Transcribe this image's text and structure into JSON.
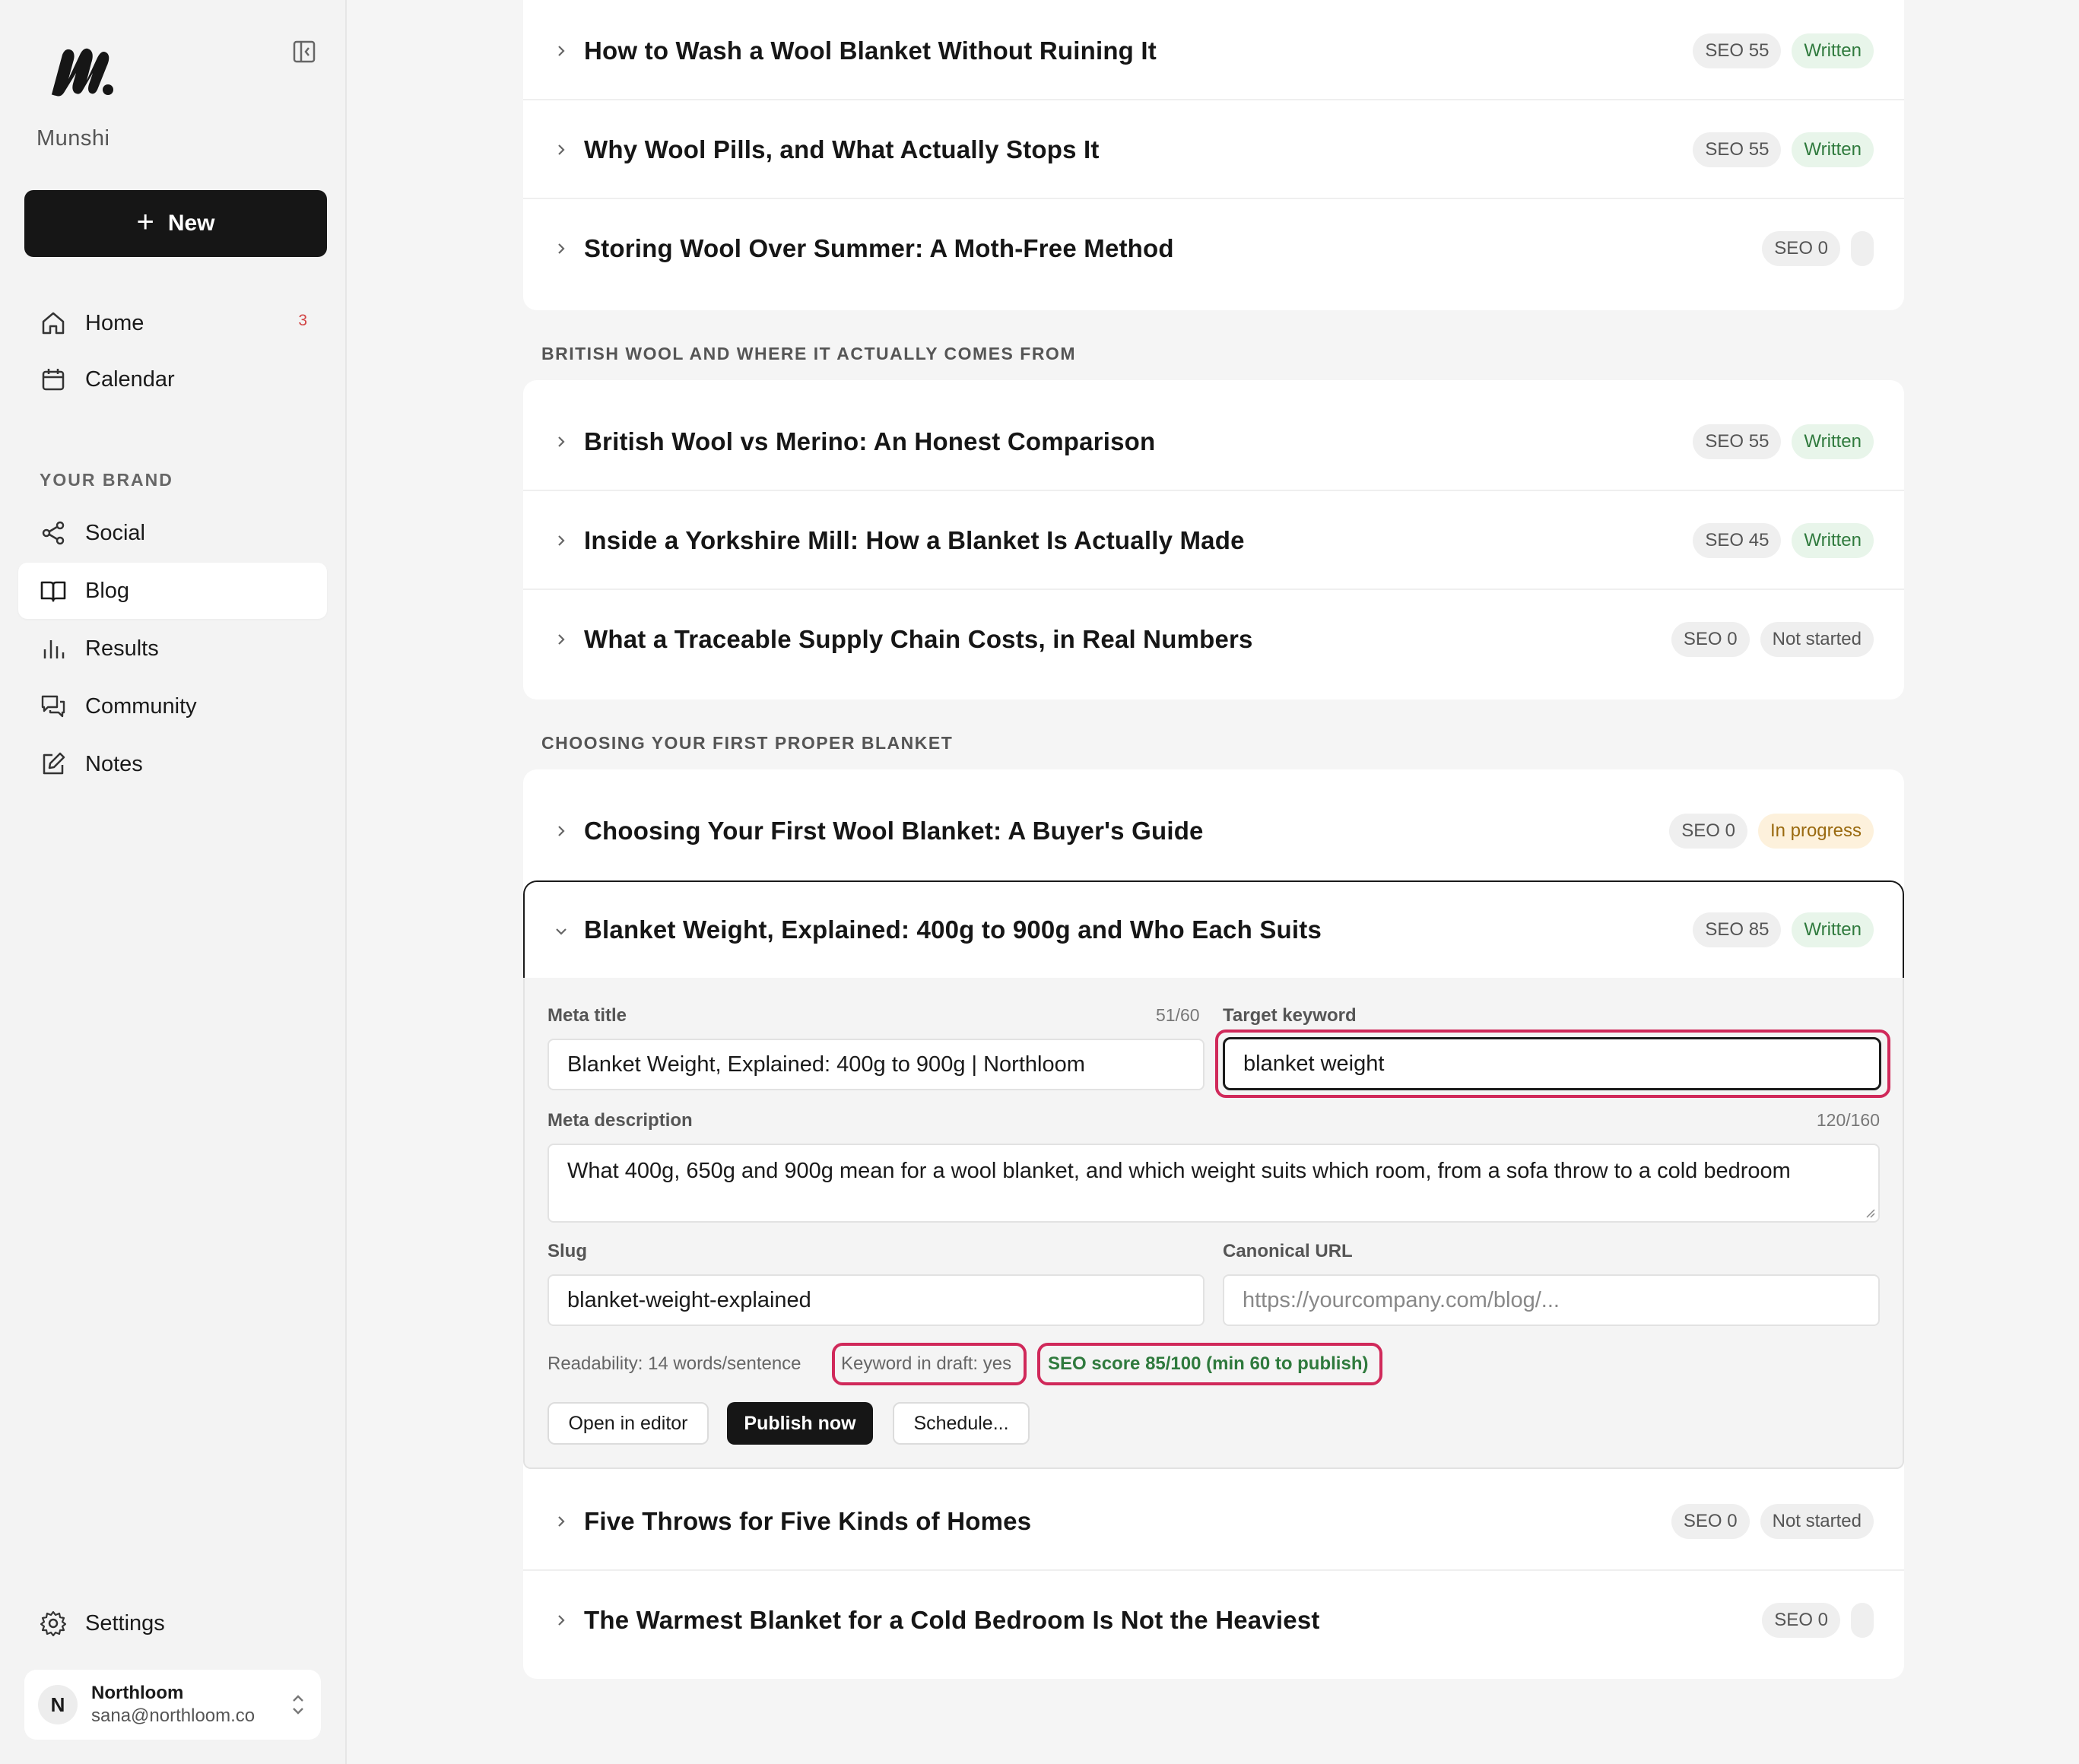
{
  "brand": {
    "name": "Munshi"
  },
  "sidebar": {
    "new_label": "New",
    "nav": [
      {
        "label": "Home",
        "badge": "3",
        "icon": "home-icon"
      },
      {
        "label": "Calendar",
        "icon": "calendar-icon"
      }
    ],
    "section_label": "YOUR BRAND",
    "brand_nav": [
      {
        "label": "Social",
        "icon": "share-icon"
      },
      {
        "label": "Blog",
        "icon": "book-icon",
        "active": true
      },
      {
        "label": "Results",
        "icon": "bar-chart-icon"
      },
      {
        "label": "Community",
        "icon": "chat-icon"
      },
      {
        "label": "Notes",
        "icon": "edit-icon"
      }
    ],
    "settings_label": "Settings",
    "account": {
      "initial": "N",
      "name": "Northloom",
      "email": "sana@northloom.co"
    }
  },
  "groups": [
    {
      "label": "",
      "posts": [
        {
          "title": "How to Wash a Wool Blanket Without Ruining It",
          "seo": "SEO 55",
          "status": "Written"
        },
        {
          "title": "Why Wool Pills, and What Actually Stops It",
          "seo": "SEO 55",
          "status": "Written"
        },
        {
          "title": "Storing Wool Over Summer: A Moth-Free Method",
          "seo": "SEO 0",
          "status": ""
        }
      ]
    },
    {
      "label": "BRITISH WOOL AND WHERE IT ACTUALLY COMES FROM",
      "posts": [
        {
          "title": "British Wool vs Merino: An Honest Comparison",
          "seo": "SEO 55",
          "status": "Written"
        },
        {
          "title": "Inside a Yorkshire Mill: How a Blanket Is Actually Made",
          "seo": "SEO 45",
          "status": "Written"
        },
        {
          "title": "What a Traceable Supply Chain Costs, in Real Numbers",
          "seo": "SEO 0",
          "status": "Not started"
        }
      ]
    },
    {
      "label": "CHOOSING YOUR FIRST PROPER BLANKET",
      "posts": [
        {
          "title": "Choosing Your First Wool Blanket: A Buyer's Guide",
          "seo": "SEO 0",
          "status": "In progress"
        },
        {
          "title": "Blanket Weight, Explained: 400g to 900g and Who Each Suits",
          "seo": "SEO 85",
          "status": "Written"
        },
        {
          "title": "Five Throws for Five Kinds of Homes",
          "seo": "SEO 0",
          "status": "Not started"
        },
        {
          "title": "The Warmest Blanket for a Cold Bedroom Is Not the Heaviest",
          "seo": "SEO 0",
          "status": ""
        }
      ]
    }
  ],
  "editor": {
    "meta_title_label": "Meta title",
    "meta_title_count": "51/60",
    "meta_title_value": "Blanket Weight, Explained: 400g to 900g | Northloom",
    "target_keyword_label": "Target keyword",
    "target_keyword_value": "blanket weight",
    "meta_description_label": "Meta description",
    "meta_description_count": "120/160",
    "meta_description_value": "What 400g, 650g and 900g mean for a wool blanket, and which weight suits which room, from a sofa throw to a cold bedroom",
    "slug_label": "Slug",
    "slug_value": "blanket-weight-explained",
    "canonical_label": "Canonical URL",
    "canonical_placeholder": "https://yourcompany.com/blog/...",
    "readability": "Readability: 14 words/sentence",
    "keyword_in_draft": "Keyword in draft: yes",
    "seo_score": "SEO score 85/100 (min 60 to publish)",
    "open_editor_label": "Open in editor",
    "publish_label": "Publish now",
    "schedule_label": "Schedule..."
  },
  "colors": {
    "accent_dark": "#161616",
    "written_green": "#2f7a3d",
    "highlight": "#d0295a",
    "in_progress": "#9a6a10"
  }
}
